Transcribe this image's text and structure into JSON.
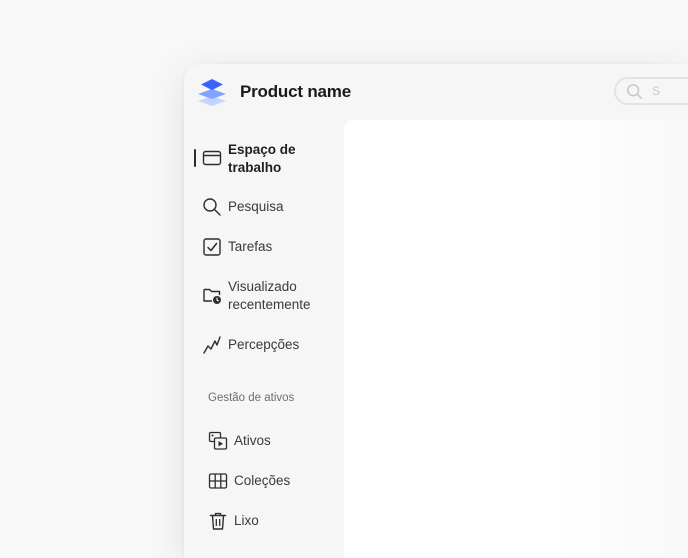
{
  "app": {
    "product_name": "Product name",
    "brand_colors": {
      "logo_top": "#3b63fb",
      "logo_middle": "#7ea5ff",
      "logo_bottom": "#c3d5ff"
    }
  },
  "header": {
    "search": {
      "icon": "search-icon",
      "visible_text": "S"
    }
  },
  "sidebar": {
    "items": [
      {
        "id": "workspace",
        "label_line1": "Espaço de",
        "label_line2": "trabalho",
        "icon": "workspace-icon",
        "selected": true
      },
      {
        "id": "search",
        "label": "Pesquisa",
        "icon": "search-icon",
        "selected": false
      },
      {
        "id": "tasks",
        "label": "Tarefas",
        "icon": "checkbox-icon",
        "selected": false
      },
      {
        "id": "recent",
        "label_line1": "Visualizado",
        "label_line2": "recentemente",
        "icon": "folder-clock-icon",
        "selected": false
      },
      {
        "id": "insights",
        "label": "Percepções",
        "icon": "insights-icon",
        "selected": false
      }
    ],
    "asset_section": {
      "heading": "Gestão de ativos",
      "items": [
        {
          "id": "assets",
          "label": "Ativos",
          "icon": "assets-icon"
        },
        {
          "id": "collections",
          "label": "Coleções",
          "icon": "grid-icon"
        },
        {
          "id": "trash",
          "label": "Lixo",
          "icon": "trash-icon"
        }
      ]
    }
  }
}
